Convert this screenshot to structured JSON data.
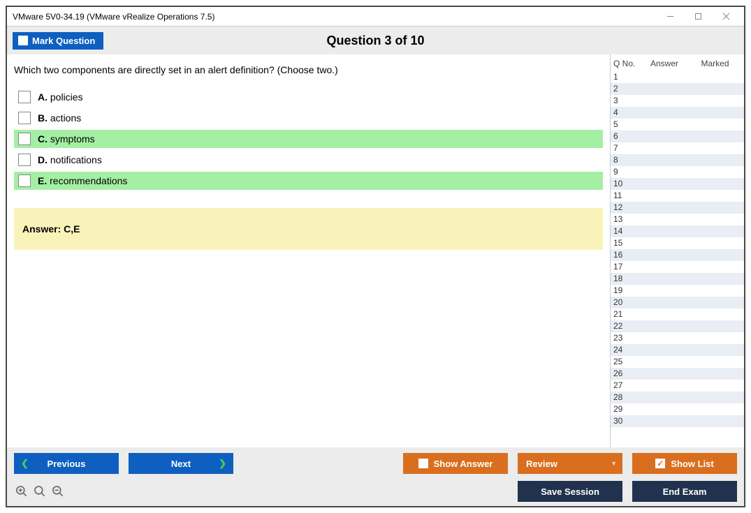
{
  "window": {
    "title": "VMware 5V0-34.19 (VMware vRealize Operations 7.5)"
  },
  "header": {
    "mark_label": "Mark Question",
    "question_title": "Question 3 of 10"
  },
  "question": {
    "text": "Which two components are directly set in an alert definition? (Choose two.)",
    "options": [
      {
        "letter": "A.",
        "text": "policies",
        "correct": false
      },
      {
        "letter": "B.",
        "text": "actions",
        "correct": false
      },
      {
        "letter": "C.",
        "text": "symptoms",
        "correct": true
      },
      {
        "letter": "D.",
        "text": "notifications",
        "correct": false
      },
      {
        "letter": "E.",
        "text": "recommendations",
        "correct": true
      }
    ],
    "answer_label": "Answer: C,E"
  },
  "sidebar": {
    "col_qno": "Q No.",
    "col_answer": "Answer",
    "col_marked": "Marked",
    "rows": [
      1,
      2,
      3,
      4,
      5,
      6,
      7,
      8,
      9,
      10,
      11,
      12,
      13,
      14,
      15,
      16,
      17,
      18,
      19,
      20,
      21,
      22,
      23,
      24,
      25,
      26,
      27,
      28,
      29,
      30
    ]
  },
  "footer": {
    "previous": "Previous",
    "next": "Next",
    "show_answer": "Show Answer",
    "review": "Review",
    "show_list": "Show List",
    "save_session": "Save Session",
    "end_exam": "End Exam"
  }
}
